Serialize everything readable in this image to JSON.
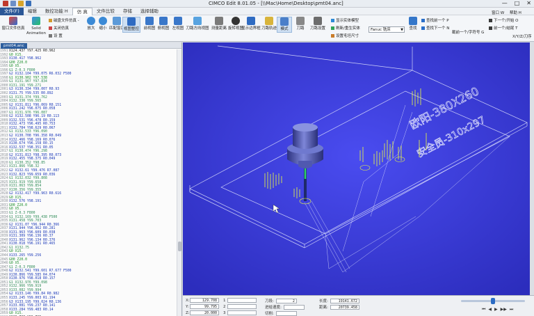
{
  "window": {
    "title": "CIMCO Edit 8.01.05 - [\\\\Mac\\Home\\Desktop\\pmt04.anc]",
    "controls": [
      "—",
      "□",
      "✕"
    ]
  },
  "tabs": [
    "文件(F)",
    "编辑",
    "数控功能 H",
    "仿 真",
    "文件比较",
    "存储",
    "选择辅助"
  ],
  "ribbon": {
    "big_buttons": [
      {
        "label": "窗口文件仿真",
        "icon": "cube-window-icon"
      },
      {
        "label": "Solid Animation",
        "icon": "solid-animation-icon"
      },
      {
        "label": "放大",
        "icon": "zoom-in-icon"
      },
      {
        "label": "缩小",
        "icon": "zoom-out-icon"
      },
      {
        "label": "匹配窗口",
        "icon": "fit-window-icon"
      },
      {
        "label": "视图整控",
        "icon": "view-control-icon"
      },
      {
        "label": "前视图",
        "icon": "front-view-icon"
      },
      {
        "label": "俯视图",
        "icon": "top-view-icon"
      },
      {
        "label": "左视图",
        "icon": "left-view-icon"
      },
      {
        "label": "刀路方向视图",
        "icon": "toolpath-view-icon"
      },
      {
        "label": "测量距离",
        "icon": "measure-icon"
      },
      {
        "label": "旋转视图",
        "icon": "rotate-view-icon"
      },
      {
        "label": "显示边界框",
        "icon": "bounding-box-icon"
      },
      {
        "label": "刀路轨迹",
        "icon": "tool-trace-icon"
      },
      {
        "label": "模式",
        "icon": "mode-icon"
      },
      {
        "label": "刀路",
        "icon": "toolpath-icon"
      },
      {
        "label": "刀路设置",
        "icon": "toolpath-settings-icon"
      }
    ],
    "small_buttons": [
      "磁盘文件仿真 -",
      "关闭仿真",
      "设 置",
      "显示实体模型",
      "刷新/重生实体",
      "设置毛坯尺寸",
      "查找前一个 P",
      "查找下一个 N",
      "截前一个/字符号 G",
      "下一个/开始 O",
      "窗口 W",
      "帮助 H",
      "前一个/结尾 T",
      "X/Y/Z/刀序"
    ],
    "combo_value": "Fanuc 铣床",
    "right_labels": [
      "查找",
      "跳转",
      "X/Y/Z/刀序"
    ]
  },
  "editor": {
    "tab": "pmt04.anc",
    "lines": [
      {
        "no": "1991",
        "code": "X124.437 Y97.425 R0.962",
        "style": "tx"
      },
      {
        "no": "1992",
        "code": "G0 X15.",
        "style": "g0"
      },
      {
        "no": "1993",
        "code": "X130.417 Y98.962",
        "style": "g1"
      },
      {
        "no": "1994",
        "code": "G00 Z20.0",
        "style": "g0"
      },
      {
        "no": "1995",
        "code": "G0 X5.",
        "style": "g0"
      },
      {
        "no": "1996",
        "code": "G1 Z-0.3 F800",
        "style": "cm"
      },
      {
        "no": "1997",
        "code": "G2 X132.104 Y99.075 R6.032 F500",
        "style": "g1"
      },
      {
        "no": "1998",
        "code": "G1 X130.902 Y97.538",
        "style": "g0"
      },
      {
        "no": "1999",
        "code": "G1 X131.967 Y97.834",
        "style": "cm"
      },
      {
        "no": "2000",
        "code": "X131.191 Y99.271",
        "style": "cm"
      },
      {
        "no": "2001",
        "code": "G3 X130.334 Y99.007 R0.93",
        "style": "g1"
      },
      {
        "no": "2002",
        "code": "X131.75 Y99.535 R0.892",
        "style": "g1"
      },
      {
        "no": "2003",
        "code": "G1 X131.374 Y99.762",
        "style": "cm"
      },
      {
        "no": "2004",
        "code": "X132.330 Y99.565",
        "style": "cm"
      },
      {
        "no": "2005",
        "code": "G2 X131.811 Y96.069 R0.151",
        "style": "g1"
      },
      {
        "no": "2006",
        "code": "X131.242 Y96.075 R0.058",
        "style": "g1"
      },
      {
        "no": "2007",
        "code": "G1 X131.976 Y96.087",
        "style": "cm"
      },
      {
        "no": "2008",
        "code": "G2 X132.508 Y96.19 R0.113",
        "style": "g1"
      },
      {
        "no": "2009",
        "code": "X132.531 Y96.478 R0.159",
        "style": "g1"
      },
      {
        "no": "2010",
        "code": "X132.473 Y96.495 R0.753",
        "style": "g1"
      },
      {
        "no": "2011",
        "code": "X132.784 Y98.629 R0.067",
        "style": "g1"
      },
      {
        "no": "2012",
        "code": "G1 X132.533 Y96.090",
        "style": "cm"
      },
      {
        "no": "2013",
        "code": "G2 X130.708 Y96.358 R0.049",
        "style": "g1"
      },
      {
        "no": "2014",
        "code": "X132.466 Y98.169 R0.076",
        "style": "g1"
      },
      {
        "no": "2015",
        "code": "X130.674 Y96.158 R0.15",
        "style": "g1"
      },
      {
        "no": "2016",
        "code": "X132.537 Y98.351 R0.05",
        "style": "g1"
      },
      {
        "no": "2017",
        "code": "G1 X130.474 Y96.298",
        "style": "cm"
      },
      {
        "no": "2018",
        "code": "G2 X131.813 Y98.395 R0.073",
        "style": "g1"
      },
      {
        "no": "2019",
        "code": "X132.455 Y98.375 R0.049",
        "style": "g1"
      },
      {
        "no": "2020",
        "code": "G1 X130.352 Y98.85",
        "style": "cm"
      },
      {
        "no": "2021",
        "code": "X131.866 Y98.32",
        "style": "cm"
      },
      {
        "no": "2022",
        "code": "G2 X132.61 Y99.476 R7.087",
        "style": "g1"
      },
      {
        "no": "2023",
        "code": "X132.823 Y99.659 R0.036",
        "style": "g1"
      },
      {
        "no": "2024",
        "code": "G1 X132.032 Y99.808",
        "style": "cm"
      },
      {
        "no": "2025",
        "code": "X131.919 Y99.658",
        "style": "cm"
      },
      {
        "no": "2026",
        "code": "X131.063 Y99.854",
        "style": "cm"
      },
      {
        "no": "2027",
        "code": "X130.356 Y99.355",
        "style": "cm"
      },
      {
        "no": "2028",
        "code": "G2 X132.417 Y99.963 R0.616",
        "style": "g1"
      },
      {
        "no": "2029",
        "code": "G0 X15.",
        "style": "g0"
      },
      {
        "no": "2030",
        "code": "X132.576 Y98.191",
        "style": "g1"
      },
      {
        "no": "2031",
        "code": "G00 Z20.0",
        "style": "g0"
      },
      {
        "no": "2032",
        "code": "G0 X5.",
        "style": "g0"
      },
      {
        "no": "2033",
        "code": "G1 Z-0.3 F800",
        "style": "cm"
      },
      {
        "no": "2034",
        "code": "G1 X132.169 Y99.438 F500",
        "style": "cm"
      },
      {
        "no": "2035",
        "code": "X131.458 Y99.703",
        "style": "cm"
      },
      {
        "no": "2036",
        "code": "G2 X131.07 Y96.944 R0.366",
        "style": "g1"
      },
      {
        "no": "2037",
        "code": "X131.944 Y96.962 R0.281",
        "style": "g1"
      },
      {
        "no": "2038",
        "code": "X131.963 Y96.609 R0.038",
        "style": "g1"
      },
      {
        "no": "2039",
        "code": "X131.309 Y96.136 R0.37",
        "style": "g1"
      },
      {
        "no": "2040",
        "code": "X131.962 Y96.134 R0.376",
        "style": "g1"
      },
      {
        "no": "2041",
        "code": "X130.018 Y96.191 R0.465",
        "style": "g1"
      },
      {
        "no": "2042",
        "code": "G1 X132.75",
        "style": "cm"
      },
      {
        "no": "2043",
        "code": "G0 X15.",
        "style": "g0"
      },
      {
        "no": "2044",
        "code": "X133.265 Y99.256",
        "style": "g1"
      },
      {
        "no": "2045",
        "code": "G00 Z20.0",
        "style": "g0"
      },
      {
        "no": "2046",
        "code": "G0 X5.",
        "style": "g0"
      },
      {
        "no": "2047",
        "code": "G1 Z-0.3 F800",
        "style": "cm"
      },
      {
        "no": "2048",
        "code": "G2 X132.541 Y99.601 R7.677 F500",
        "style": "g1"
      },
      {
        "no": "2049",
        "code": "X130.866 Y99.585 R4.074",
        "style": "g1"
      },
      {
        "no": "2050",
        "code": "X130.976 Y98.018 R0.157",
        "style": "g1"
      },
      {
        "no": "2051",
        "code": "G1 X132.976 Y99.098",
        "style": "cm"
      },
      {
        "no": "2052",
        "code": "X132.966 Y99.919",
        "style": "cm"
      },
      {
        "no": "2053",
        "code": "X133.082 Y99.994",
        "style": "cm"
      },
      {
        "no": "2054",
        "code": "G2 X133.146 Y99.84 R0.982",
        "style": "g1"
      },
      {
        "no": "2055",
        "code": "X133.245 Y99.003 R1.194",
        "style": "g1"
      },
      {
        "no": "2056",
        "code": "G3 X133.195 Y99.024 R0.136",
        "style": "g1"
      },
      {
        "no": "2057",
        "code": "X133.081 Y99.237 R0.141",
        "style": "g1"
      },
      {
        "no": "2058",
        "code": "X133.284 Y99.483 R0.14",
        "style": "g1"
      },
      {
        "no": "2059",
        "code": "G0 X15.",
        "style": "g0"
      },
      {
        "no": "2060",
        "code": "X129.708 Y99.795",
        "style": "hl"
      },
      {
        "no": "2061",
        "code": "G00 Z20.0",
        "style": "cur"
      }
    ]
  },
  "viewport": {
    "background": "#3b3cd9",
    "text_on_part": [
      "欧阳-380X260",
      "安全员-310x297"
    ]
  },
  "status": {
    "x": "129.708",
    "y": "99.795",
    "z": "20.000",
    "field4": "1",
    "field5": "2",
    "field6": "3",
    "labels": [
      "刀段:",
      "进给速度:",
      "切削:"
    ],
    "vals": [
      "2",
      "",
      ""
    ],
    "length_label": "长度:",
    "length": "19141.672",
    "dist_label": "距离:",
    "dist": "20739.458",
    "playback_position": 0.5
  }
}
